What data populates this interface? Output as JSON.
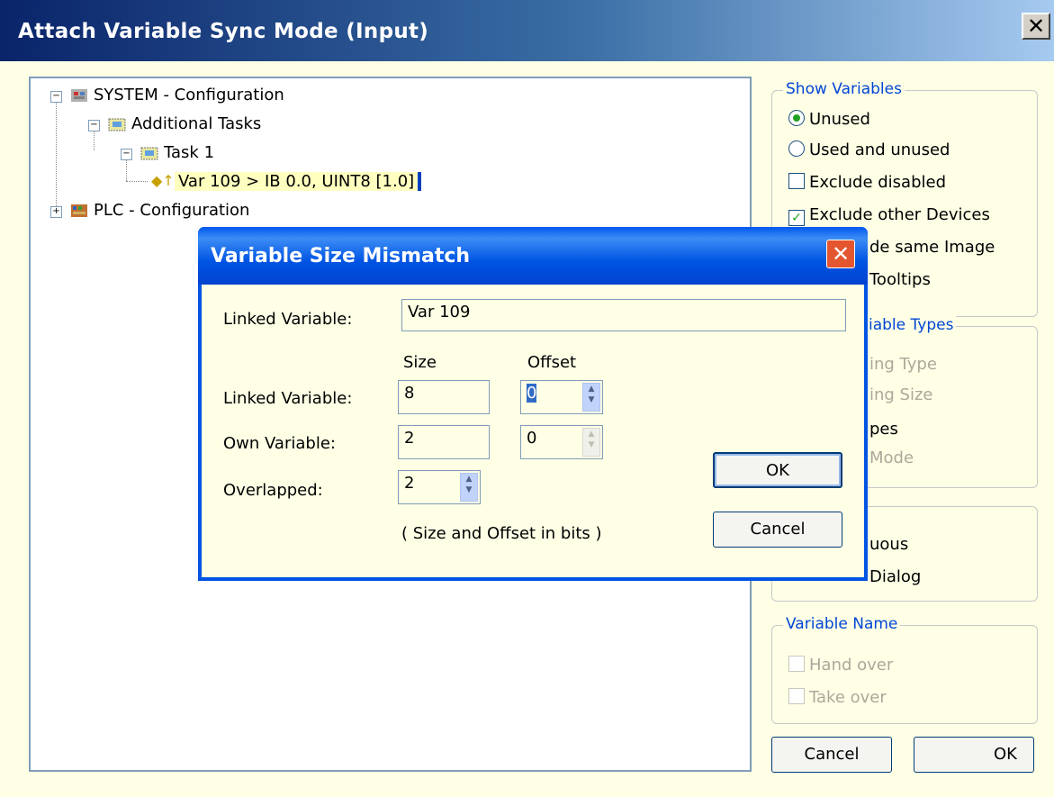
{
  "window": {
    "title": "Attach Variable Sync Mode (Input)",
    "close_glyph": "✕"
  },
  "tree": {
    "items": [
      {
        "label": "SYSTEM - Configuration",
        "expander": "−"
      },
      {
        "label": "Additional Tasks",
        "expander": "−"
      },
      {
        "label": "Task 1",
        "expander": "−"
      },
      {
        "label": "Var 109   >   IB 0.0, UINT8 [1.0]",
        "expander": ""
      },
      {
        "label": "PLC - Configuration",
        "expander": "+"
      }
    ]
  },
  "show_variables": {
    "legend": "Show Variables",
    "options": [
      {
        "label": "Unused",
        "type": "radio",
        "checked": true
      },
      {
        "label": "Used and unused",
        "type": "radio",
        "checked": false
      },
      {
        "label": "Exclude disabled",
        "type": "checkbox",
        "checked": false
      },
      {
        "label": "Exclude other Devices",
        "type": "checkbox",
        "checked": true
      },
      {
        "label": "de same Image",
        "type": "partial"
      },
      {
        "label": "Tooltips",
        "type": "partial"
      }
    ]
  },
  "variable_types": {
    "legend": "iable Types",
    "options": [
      "ing Type",
      "ing Size",
      "pes",
      "Mode"
    ]
  },
  "third_group": {
    "options": [
      "uous",
      "Dialog"
    ]
  },
  "variable_name": {
    "legend": "Variable Name",
    "options": [
      "Hand over",
      "Take over"
    ]
  },
  "buttons": {
    "cancel": "Cancel",
    "ok": "OK"
  },
  "modal": {
    "title": "Variable Size Mismatch",
    "close_glyph": "✕",
    "linked_variable_label": "Linked Variable:",
    "linked_variable_value": "Var 109",
    "size_header": "Size",
    "offset_header": "Offset",
    "rows": [
      {
        "label": "Linked Variable:",
        "size": "8",
        "offset": "0"
      },
      {
        "label": "Own Variable:",
        "size": "2",
        "offset": "0"
      },
      {
        "label": "Overlapped:",
        "size": "2"
      }
    ],
    "note": "( Size and Offset in bits )",
    "ok": "OK",
    "cancel": "Cancel"
  }
}
